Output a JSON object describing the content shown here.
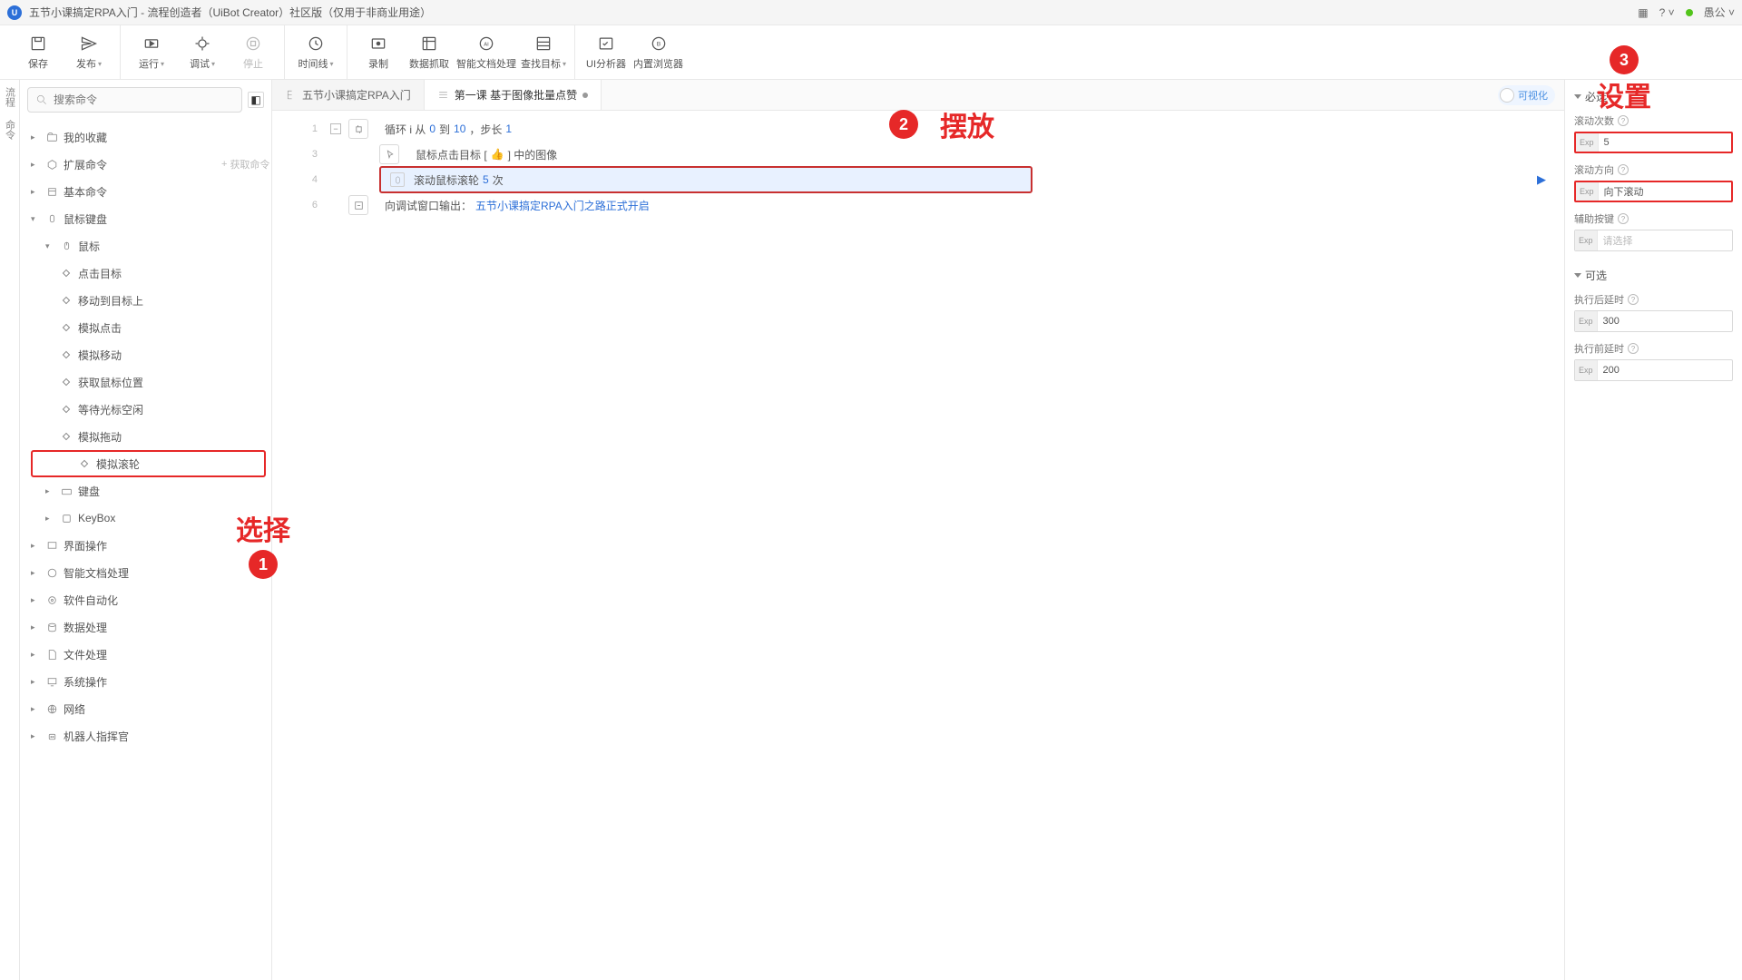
{
  "titlebar": {
    "title": "五节小课搞定RPA入门 - 流程创造者（UiBot Creator）社区版（仅用于非商业用途）",
    "user": "愚公"
  },
  "toolbar": {
    "g1": {
      "save": "保存",
      "publish": "发布"
    },
    "g2": {
      "run": "运行",
      "debug": "调试",
      "stop": "停止"
    },
    "g3": {
      "timeline": "时间线"
    },
    "g4": {
      "record": "录制",
      "capture": "数据抓取",
      "doc": "智能文档处理",
      "target": "查找目标"
    },
    "g5": {
      "ui": "UI分析器",
      "browser": "内置浏览器"
    }
  },
  "leftbar": {
    "a": "流程",
    "b": "命令"
  },
  "search": {
    "placeholder": "搜索命令",
    "getcmd": "获取命令"
  },
  "tree": {
    "fav": "我的收藏",
    "ext": "扩展命令",
    "basic": "基本命令",
    "mouse_kb": "鼠标键盘",
    "mouse": "鼠标",
    "m": {
      "click": "点击目标",
      "moveto": "移动到目标上",
      "simclick": "模拟点击",
      "simmove": "模拟移动",
      "getpos": "获取鼠标位置",
      "waitcursor": "等待光标空闲",
      "simdrag": "模拟拖动",
      "simwheel": "模拟滚轮"
    },
    "keyboard": "键盘",
    "keybox": "KeyBox",
    "ui": "界面操作",
    "smartdoc": "智能文档处理",
    "autosoft": "软件自动化",
    "dataproc": "数据处理",
    "fileproc": "文件处理",
    "sysop": "系统操作",
    "net": "网络",
    "robot": "机器人指挥官"
  },
  "tabs": {
    "tab1": "五节小课搞定RPA入门",
    "tab2": "第一课 基于图像批量点赞",
    "viz": "可视化"
  },
  "code": {
    "l1a": "循环 i 从 ",
    "l1b": "0",
    "l1c": " 到 ",
    "l1d": "10",
    "l1e": " ，步长 ",
    "l1f": "1",
    "l3a": "鼠标点击目标 [ ",
    "l3b": " ] 中的图像",
    "l4a": "滚动鼠标滚轮 ",
    "l4b": "5",
    "l4c": " 次",
    "l6a": "向调试窗口输出：",
    "l6b": "五节小课搞定RPA入门之路正式开启"
  },
  "props": {
    "required": "必选",
    "optional": "可选",
    "scroll_count": "滚动次数",
    "scroll_count_val": "5",
    "scroll_dir": "滚动方向",
    "scroll_dir_val": "向下滚动",
    "aux_key": "辅助按键",
    "aux_key_ph": "请选择",
    "delay_after": "执行后延时",
    "delay_after_val": "300",
    "delay_before": "执行前延时",
    "delay_before_val": "200",
    "exp": "Exp"
  },
  "anno": {
    "select": "选择",
    "place": "摆放",
    "setup": "设置"
  }
}
